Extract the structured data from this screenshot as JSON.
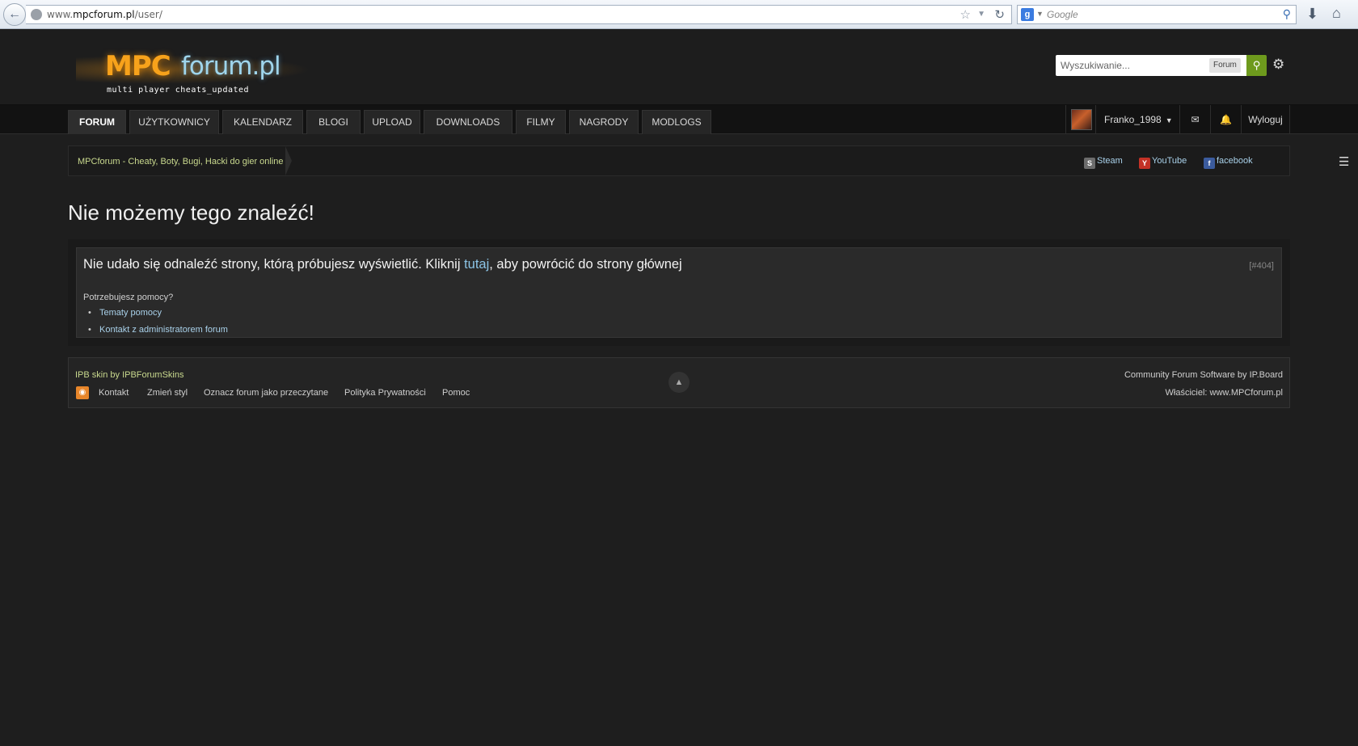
{
  "browser": {
    "url_prefix": "www.",
    "url_domain": "mpcforum.pl",
    "url_path": "/user/",
    "search_engine": "g",
    "search_placeholder": "Google"
  },
  "header": {
    "logo_mpc": "MPC",
    "logo_forum": "forum.pl",
    "logo_tagline": "multi player cheats_updated",
    "search_placeholder": "Wyszukiwanie...",
    "search_scope": "Forum"
  },
  "nav": {
    "tabs": [
      {
        "label": "FORUM"
      },
      {
        "label": "UŻYTKOWNICY"
      },
      {
        "label": "KALENDARZ"
      },
      {
        "label": "BLOGI"
      },
      {
        "label": "UPLOAD"
      },
      {
        "label": "DOWNLOADS"
      },
      {
        "label": "FILMY"
      },
      {
        "label": "NAGRODY"
      },
      {
        "label": "MODLOGS"
      }
    ],
    "username": "Franko_1998",
    "logout": "Wyloguj"
  },
  "breadcrumb": {
    "home": "MPCforum - Cheaty, Boty, Bugi, Hacki do gier online",
    "social": [
      {
        "label": "Steam",
        "icon": "steam-icon"
      },
      {
        "label": "YouTube",
        "icon": "youtube-icon"
      },
      {
        "label": "facebook",
        "icon": "facebook-icon"
      }
    ]
  },
  "error": {
    "title": "Nie możemy tego znaleźć!",
    "message_before": "Nie udało się odnaleźć strony, którą próbujesz wyświetlić. Kliknij ",
    "message_link": "tutaj",
    "message_after": ", aby powrócić do strony głównej",
    "code": "[#404]",
    "help_question": "Potrzebujesz pomocy?",
    "help_links": [
      "Tematy pomocy",
      "Kontakt z administratorem forum"
    ]
  },
  "footer": {
    "skin_credit": "IPB skin by IPBForumSkins",
    "links": [
      "Kontakt",
      "Zmień styl",
      "Oznacz forum jako przeczytane",
      "Polityka Prywatności",
      "Pomoc"
    ],
    "software": "Community Forum Software by IP.Board",
    "owner": "Właściciel: www.MPCforum.pl"
  },
  "colors": {
    "accent_green": "#6e9a1d",
    "link_blue": "#8cc4e6",
    "crumb_green": "#c9d98e",
    "background": "#1e1e1e"
  }
}
